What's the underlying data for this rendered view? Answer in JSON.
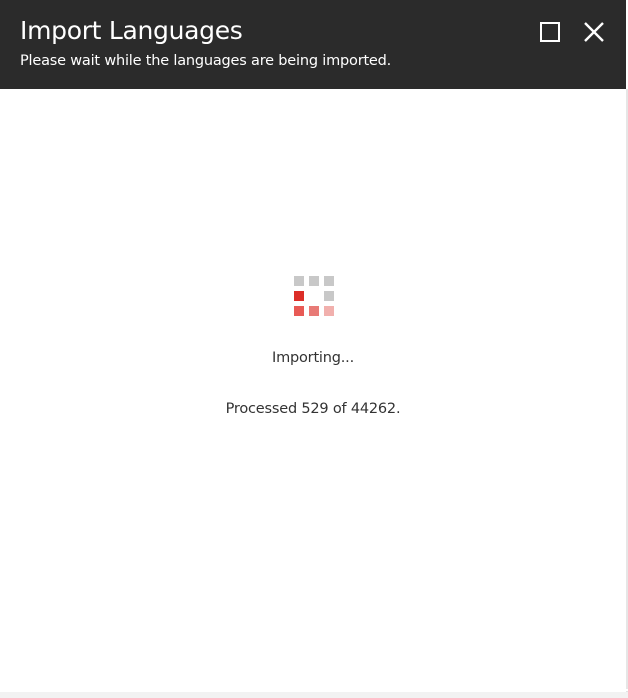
{
  "dialog": {
    "title": "Import Languages",
    "subtitle": "Please wait while the languages are being imported.",
    "maximize_icon": "maximize-icon",
    "close_icon": "close-icon"
  },
  "progress": {
    "status": "Importing...",
    "processed_text": "Processed 529 of 44262.",
    "processed": 529,
    "total": 44262
  },
  "colors": {
    "header_bg": "#2b2b2b",
    "spinner_grey": "#c8c8c8",
    "spinner_red": "#dc2e28",
    "spinner_red_mid": "#e87a76",
    "spinner_red_light": "#f1b0ad"
  }
}
